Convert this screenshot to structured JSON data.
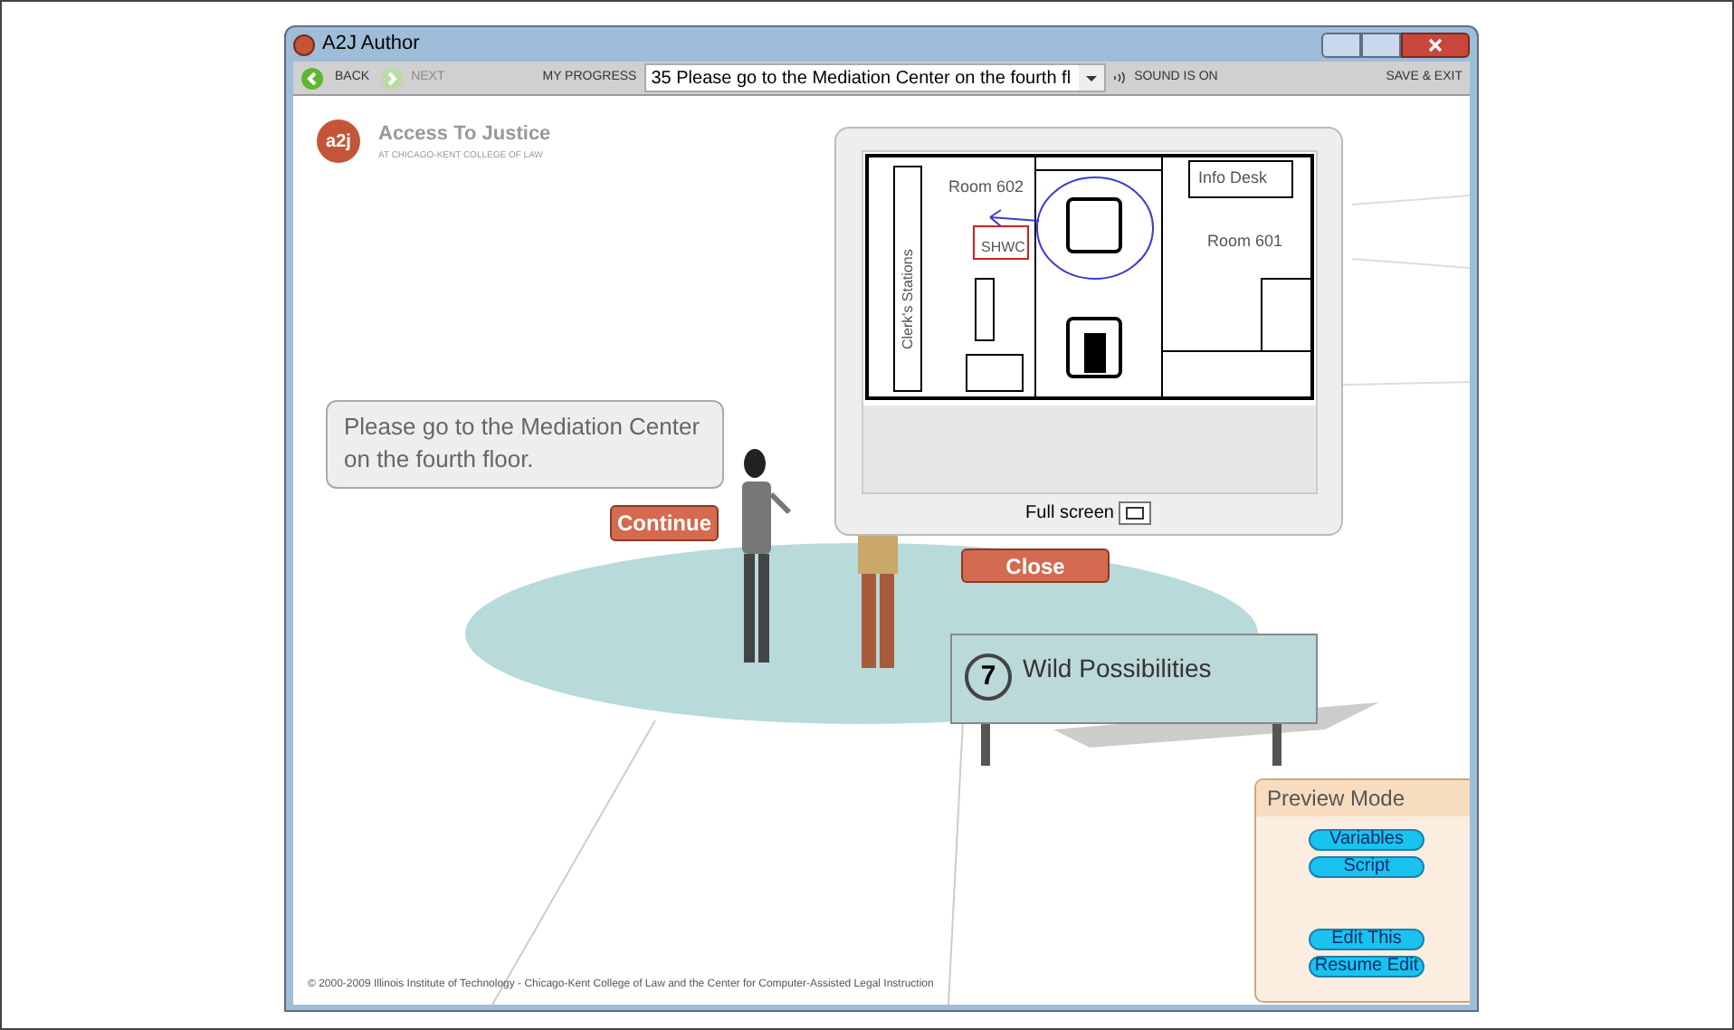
{
  "window": {
    "title": "A2J Author"
  },
  "toolbar": {
    "back": {
      "label": "BACK",
      "disabled": false
    },
    "next": {
      "label": "NEXT",
      "disabled": true
    },
    "progress_label": "MY PROGRESS",
    "progress_value": "35 Please go to the Mediation Center on the fourth fl",
    "sound": "SOUND IS ON",
    "save_exit": "SAVE & EXIT"
  },
  "logo": {
    "badge": "a2j",
    "title": "Access To Justice",
    "subtitle": "AT CHICAGO-KENT COLLEGE OF LAW"
  },
  "speech": {
    "text": "Please go to the Mediation Center on the fourth floor.",
    "button": "Continue"
  },
  "map_popup": {
    "labels": {
      "room_602": "Room 602",
      "shwc": "SHWC",
      "clerks": "Clerk's Stations",
      "info_desk": "Info Desk",
      "room_601": "Room 601"
    },
    "full_screen": "Full screen",
    "close": "Close"
  },
  "sign": {
    "number": "7",
    "text": "Wild Possibilities"
  },
  "preview": {
    "title": "Preview Mode",
    "top_buttons": [
      "Variables",
      "Script"
    ],
    "bottom_buttons": [
      "Edit This",
      "Resume Edit"
    ]
  },
  "footer": "© 2000-2009 Illinois Institute of Technology - Chicago-Kent College of Law and the Center for Computer-Assisted Legal Instruction"
}
